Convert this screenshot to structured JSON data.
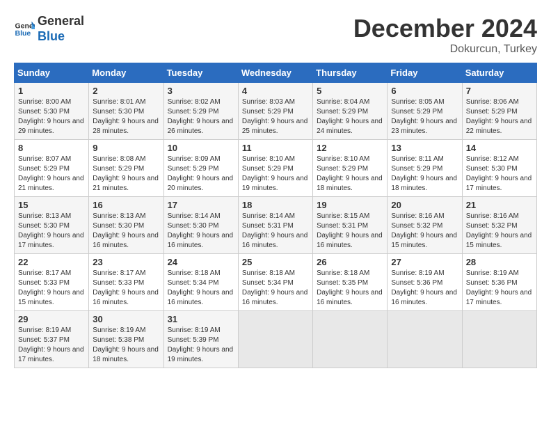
{
  "header": {
    "logo_line1": "General",
    "logo_line2": "Blue",
    "month": "December 2024",
    "location": "Dokurcun, Turkey"
  },
  "weekdays": [
    "Sunday",
    "Monday",
    "Tuesday",
    "Wednesday",
    "Thursday",
    "Friday",
    "Saturday"
  ],
  "weeks": [
    [
      {
        "day": 1,
        "sunrise": "8:00 AM",
        "sunset": "5:30 PM",
        "daylight": "9 hours and 29 minutes."
      },
      {
        "day": 2,
        "sunrise": "8:01 AM",
        "sunset": "5:30 PM",
        "daylight": "9 hours and 28 minutes."
      },
      {
        "day": 3,
        "sunrise": "8:02 AM",
        "sunset": "5:29 PM",
        "daylight": "9 hours and 26 minutes."
      },
      {
        "day": 4,
        "sunrise": "8:03 AM",
        "sunset": "5:29 PM",
        "daylight": "9 hours and 25 minutes."
      },
      {
        "day": 5,
        "sunrise": "8:04 AM",
        "sunset": "5:29 PM",
        "daylight": "9 hours and 24 minutes."
      },
      {
        "day": 6,
        "sunrise": "8:05 AM",
        "sunset": "5:29 PM",
        "daylight": "9 hours and 23 minutes."
      },
      {
        "day": 7,
        "sunrise": "8:06 AM",
        "sunset": "5:29 PM",
        "daylight": "9 hours and 22 minutes."
      }
    ],
    [
      {
        "day": 8,
        "sunrise": "8:07 AM",
        "sunset": "5:29 PM",
        "daylight": "9 hours and 21 minutes."
      },
      {
        "day": 9,
        "sunrise": "8:08 AM",
        "sunset": "5:29 PM",
        "daylight": "9 hours and 21 minutes."
      },
      {
        "day": 10,
        "sunrise": "8:09 AM",
        "sunset": "5:29 PM",
        "daylight": "9 hours and 20 minutes."
      },
      {
        "day": 11,
        "sunrise": "8:10 AM",
        "sunset": "5:29 PM",
        "daylight": "9 hours and 19 minutes."
      },
      {
        "day": 12,
        "sunrise": "8:10 AM",
        "sunset": "5:29 PM",
        "daylight": "9 hours and 18 minutes."
      },
      {
        "day": 13,
        "sunrise": "8:11 AM",
        "sunset": "5:29 PM",
        "daylight": "9 hours and 18 minutes."
      },
      {
        "day": 14,
        "sunrise": "8:12 AM",
        "sunset": "5:30 PM",
        "daylight": "9 hours and 17 minutes."
      }
    ],
    [
      {
        "day": 15,
        "sunrise": "8:13 AM",
        "sunset": "5:30 PM",
        "daylight": "9 hours and 17 minutes."
      },
      {
        "day": 16,
        "sunrise": "8:13 AM",
        "sunset": "5:30 PM",
        "daylight": "9 hours and 16 minutes."
      },
      {
        "day": 17,
        "sunrise": "8:14 AM",
        "sunset": "5:30 PM",
        "daylight": "9 hours and 16 minutes."
      },
      {
        "day": 18,
        "sunrise": "8:14 AM",
        "sunset": "5:31 PM",
        "daylight": "9 hours and 16 minutes."
      },
      {
        "day": 19,
        "sunrise": "8:15 AM",
        "sunset": "5:31 PM",
        "daylight": "9 hours and 16 minutes."
      },
      {
        "day": 20,
        "sunrise": "8:16 AM",
        "sunset": "5:32 PM",
        "daylight": "9 hours and 15 minutes."
      },
      {
        "day": 21,
        "sunrise": "8:16 AM",
        "sunset": "5:32 PM",
        "daylight": "9 hours and 15 minutes."
      }
    ],
    [
      {
        "day": 22,
        "sunrise": "8:17 AM",
        "sunset": "5:33 PM",
        "daylight": "9 hours and 15 minutes."
      },
      {
        "day": 23,
        "sunrise": "8:17 AM",
        "sunset": "5:33 PM",
        "daylight": "9 hours and 16 minutes."
      },
      {
        "day": 24,
        "sunrise": "8:18 AM",
        "sunset": "5:34 PM",
        "daylight": "9 hours and 16 minutes."
      },
      {
        "day": 25,
        "sunrise": "8:18 AM",
        "sunset": "5:34 PM",
        "daylight": "9 hours and 16 minutes."
      },
      {
        "day": 26,
        "sunrise": "8:18 AM",
        "sunset": "5:35 PM",
        "daylight": "9 hours and 16 minutes."
      },
      {
        "day": 27,
        "sunrise": "8:19 AM",
        "sunset": "5:36 PM",
        "daylight": "9 hours and 16 minutes."
      },
      {
        "day": 28,
        "sunrise": "8:19 AM",
        "sunset": "5:36 PM",
        "daylight": "9 hours and 17 minutes."
      }
    ],
    [
      {
        "day": 29,
        "sunrise": "8:19 AM",
        "sunset": "5:37 PM",
        "daylight": "9 hours and 17 minutes."
      },
      {
        "day": 30,
        "sunrise": "8:19 AM",
        "sunset": "5:38 PM",
        "daylight": "9 hours and 18 minutes."
      },
      {
        "day": 31,
        "sunrise": "8:19 AM",
        "sunset": "5:39 PM",
        "daylight": "9 hours and 19 minutes."
      },
      null,
      null,
      null,
      null
    ]
  ],
  "labels": {
    "sunrise": "Sunrise:",
    "sunset": "Sunset:",
    "daylight": "Daylight:"
  }
}
